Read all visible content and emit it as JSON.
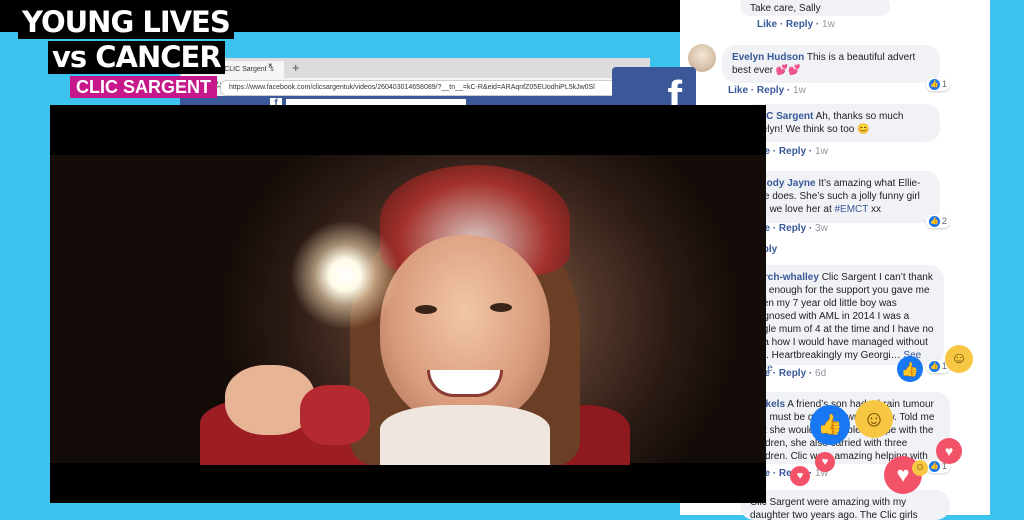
{
  "logo": {
    "line1": "YOUNG LIVES",
    "line2": "vs CANCER",
    "brand": "CLIC SARGENT"
  },
  "browser": {
    "tab_title": "#KidSanta: CLIC Sargent ‘s",
    "tab_close": "×",
    "new_tab": "+",
    "nav_icons": "←→↻",
    "url": "https://www.facebook.com/clicsargentuk/videos/260403014658089/?__tn__=kC-R&eid=ARAqnfZ05EUodhiPL5kJw0Sl"
  },
  "fb_tile_letter": "f",
  "comments": [
    {
      "id": "sally",
      "text": "Take care, Sally",
      "actions": [
        "Like",
        "Reply"
      ],
      "time": "1w"
    },
    {
      "id": "evelyn",
      "author": "Evelyn Hudson",
      "text": " This is a beautiful advert best ever 💕💕",
      "actions": [
        "Like",
        "Reply"
      ],
      "time": "1w",
      "reactions": "1"
    },
    {
      "id": "clic",
      "author": "CLIC Sargent",
      "text": " Ah, thanks so much Evelyn! We think so too 😊",
      "actions": [
        "Like",
        "Reply"
      ],
      "time": "1w"
    },
    {
      "id": "melody",
      "author": "Melody Jayne",
      "text": " It’s amazing what Ellie-Mae does. She’s such a jolly funny girl and we love her at ",
      "tag": "#EMCT",
      "text_end": " xx",
      "actions": [
        "Like",
        "Reply"
      ],
      "time": "3w",
      "reactions": "2",
      "reply_label": "Reply"
    },
    {
      "id": "march",
      "author": "March-whalley",
      "text": " Clic Sargent I can’t thank you enough for the support you gave me when my 7 year old little boy was diagnosed with AML in 2014 I was a single mum of 4 at the time and I have no idea how I would have managed without you. Heartbreakingly my Georgi…",
      "see_more": "See more",
      "actions": [
        "Like",
        "Reply"
      ],
      "time": "6d",
      "reactions": "1"
    },
    {
      "id": "nickels",
      "author": "Nickels",
      "text": " A friend’s son had a brain tumour and must be quite grown up now. Told me that she wouldn’t be able to cope with the children, she also carried with three children. Clic were amazing helping with accomodation etc.",
      "actions": [
        "Like",
        "Reply"
      ],
      "time": "1w",
      "reactions": "1"
    },
    {
      "id": "last",
      "text": "Clic Sargent were amazing with my daughter two years ago. The Clic girls"
    }
  ]
}
